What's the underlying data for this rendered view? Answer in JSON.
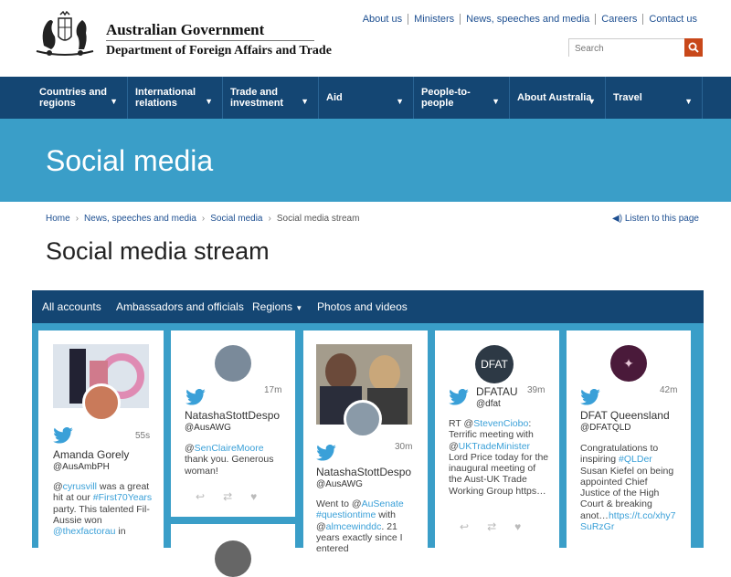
{
  "header": {
    "gov_title": "Australian Government",
    "dept_title": "Department of Foreign Affairs and Trade",
    "top_links": [
      "About us",
      "Ministers",
      "News, speeches and media",
      "Careers",
      "Contact us"
    ],
    "search_placeholder": "Search"
  },
  "nav": {
    "items": [
      {
        "label": "Countries and regions"
      },
      {
        "label": "International relations"
      },
      {
        "label": "Trade and investment"
      },
      {
        "label": "Aid"
      },
      {
        "label": "People-to-people"
      },
      {
        "label": "About Australia"
      },
      {
        "label": "Travel"
      }
    ]
  },
  "banner": {
    "title": "Social media"
  },
  "breadcrumb": {
    "items": [
      "Home",
      "News, speeches and media",
      "Social media",
      "Social media stream"
    ]
  },
  "listen_label": "Listen to this page",
  "page_title": "Social media stream",
  "tabs": [
    "All accounts",
    "Ambassadors and officials",
    "Regions",
    "Photos and videos"
  ],
  "cards": [
    {
      "time": "55s",
      "name": "Amanda Gorely",
      "handle": "@AusAmbPH",
      "body": {
        "t1": "@",
        "l1": "cyrusvill",
        "t2": " was a great hit at our ",
        "l2": "#First70Years",
        "t3": " party. This talented Fil-Aussie won ",
        "l3": "@thexfactorau",
        "t4": " in"
      }
    },
    {
      "time": "17m",
      "name": "NatashaStottDespo",
      "handle": "@AusAWG",
      "body": {
        "t1": "@",
        "l1": "SenClaireMoore",
        "t2": " thank you. Generous woman!"
      }
    },
    {
      "time": "30m",
      "name": "NatashaStottDespo",
      "handle": "@AusAWG",
      "body": {
        "t1": "Went to @",
        "l1": "AuSenate",
        "t2": " ",
        "l2": "#questiontime",
        "t3": " with @",
        "l3": "almcewinddc",
        "t4": ". 21 years exactly since I entered"
      }
    },
    {
      "time": "39m",
      "name": "DFATAU",
      "handle": "@dfat",
      "avatar_text": "DFAT",
      "body": {
        "t1": "RT @",
        "l1": "StevenCiobo",
        "t2": ": Terrific meeting with @",
        "l2": "UKTradeMinister",
        "t3": " Lord Price today for the inaugural meeting of the Aust-UK Trade Working Group https…"
      }
    },
    {
      "time": "42m",
      "name": "DFAT Queensland",
      "handle": "@DFATQLD",
      "body": {
        "t1": "Congratulations to inspiring ",
        "l1": "#QLDer",
        "t2": " Susan Kiefel on being appointed Chief Justice of the High Court & breaking anot…",
        "l2": "https://t.co/xhy7SuRzGr"
      }
    }
  ],
  "colors": {
    "nav": "#144673",
    "banner": "#3a9ec8",
    "accent": "#c8481a",
    "link": "#3aa0d8"
  }
}
